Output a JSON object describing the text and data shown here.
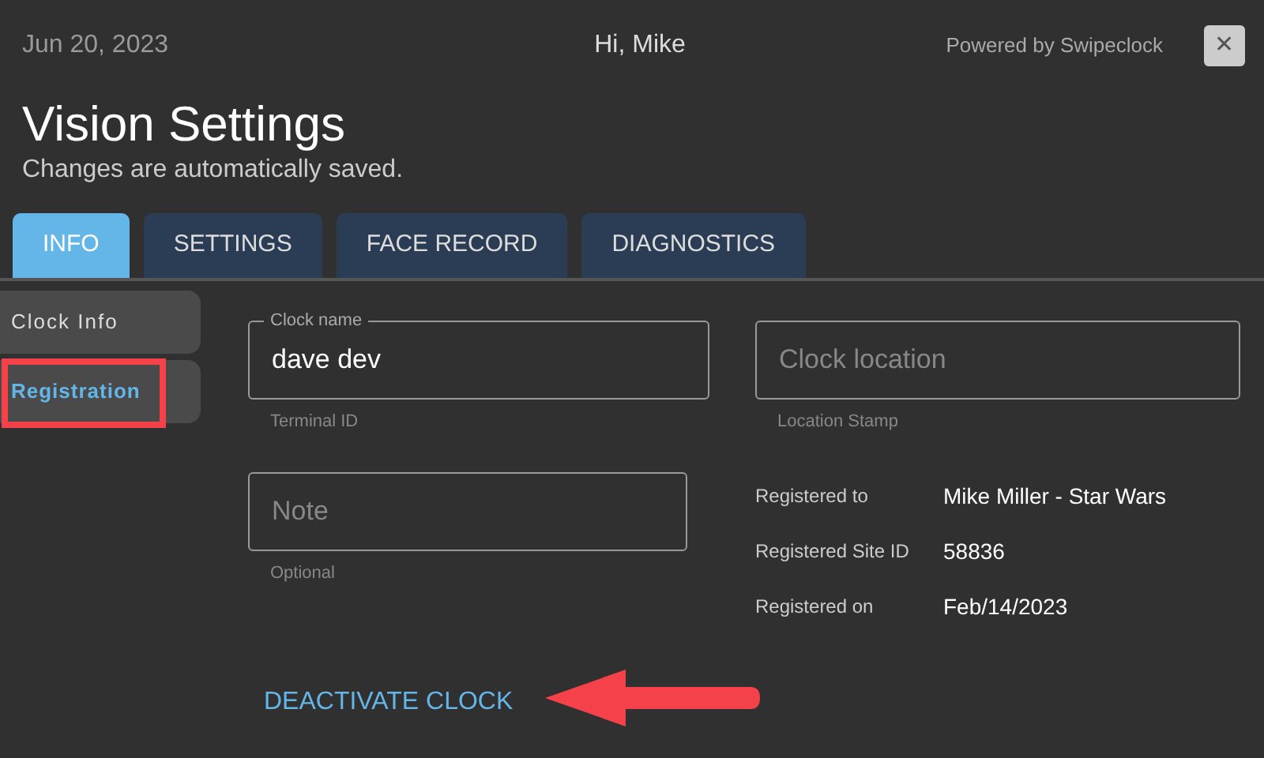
{
  "header": {
    "date": "Jun 20, 2023",
    "greeting": "Hi, Mike",
    "powered_by": "Powered by Swipeclock",
    "close": "✕"
  },
  "title": "Vision Settings",
  "subtitle": "Changes are automatically saved.",
  "tabs": [
    {
      "label": "INFO",
      "selected": true
    },
    {
      "label": "SETTINGS",
      "selected": false
    },
    {
      "label": "FACE RECORD",
      "selected": false
    },
    {
      "label": "DIAGNOSTICS",
      "selected": false
    }
  ],
  "sidebar": {
    "items": [
      {
        "label": "Clock Info",
        "selected": false
      },
      {
        "label": "Registration",
        "selected": true
      }
    ]
  },
  "fields": [
    {
      "label": "Clock name",
      "value": "dave dev",
      "helper": "Terminal ID"
    },
    {
      "placeholder": "Clock location",
      "helper": "Location Stamp"
    },
    {
      "placeholder": "Note",
      "helper": "Optional"
    }
  ],
  "registration": [
    {
      "label": "Registered to",
      "value": "Mike Miller - Star Wars"
    },
    {
      "label": "Registered Site ID",
      "value": "58836"
    },
    {
      "label": "Registered on",
      "value": "Feb/14/2023"
    }
  ],
  "deactivate": "DEACTIVATE CLOCK",
  "annotations": {
    "highlight_box": true,
    "arrow": true
  }
}
